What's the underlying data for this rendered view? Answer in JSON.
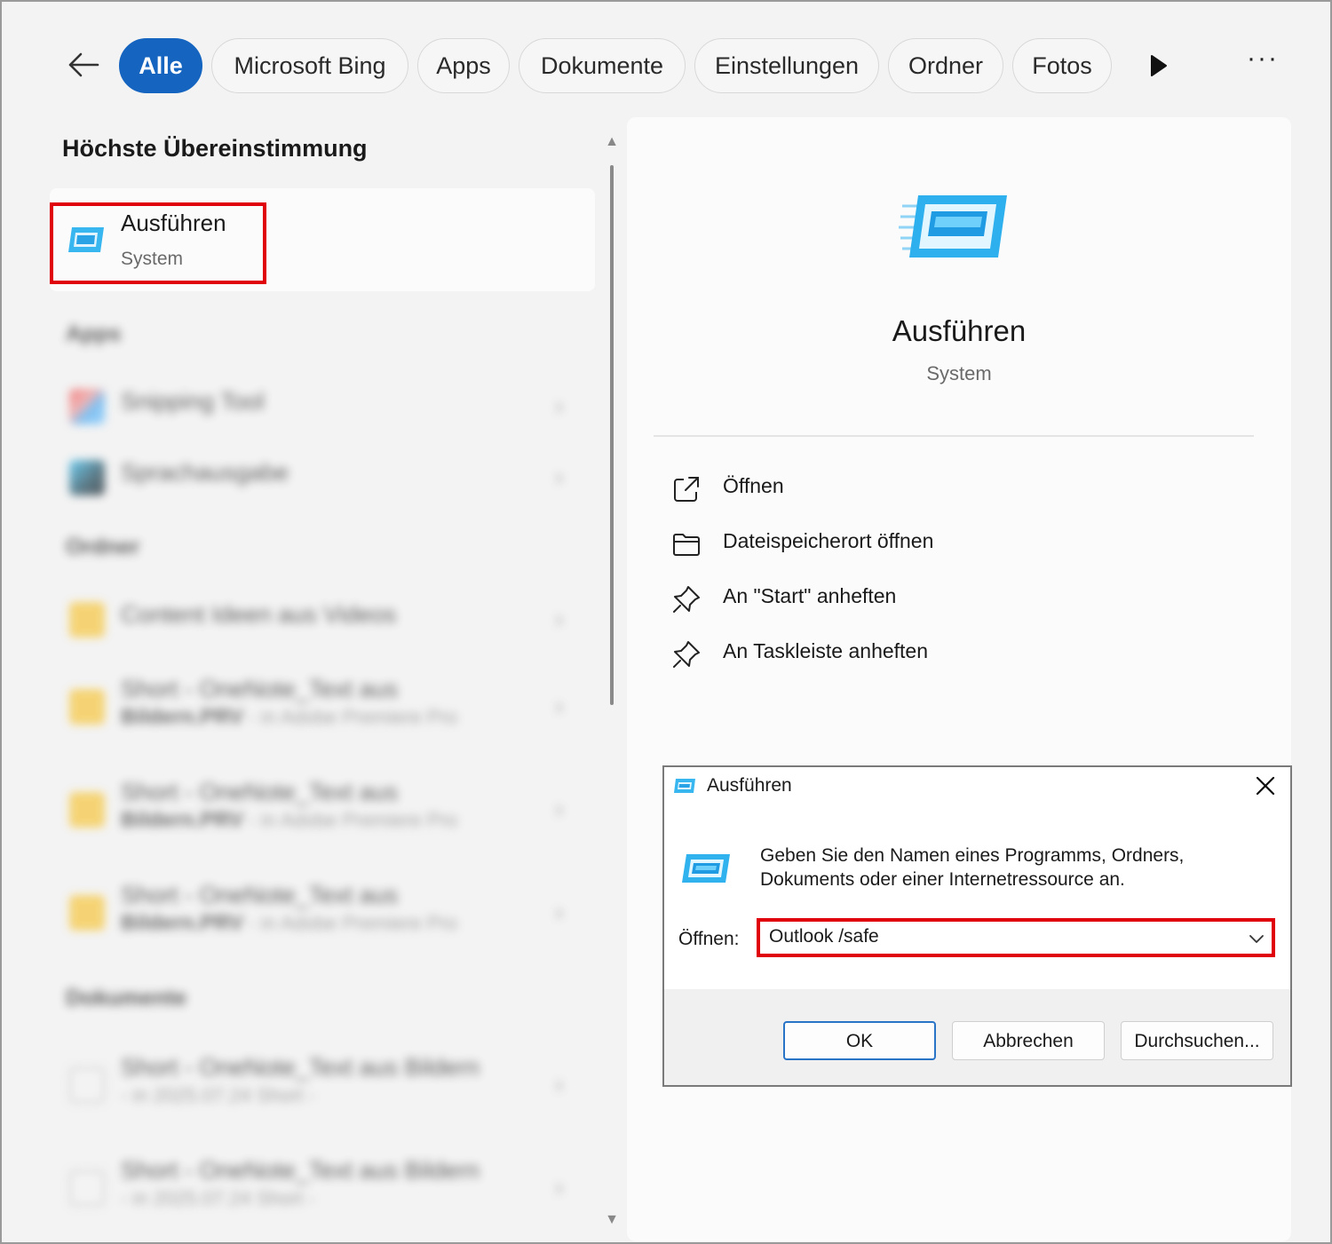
{
  "filters": {
    "tabs": [
      {
        "label": "Alle",
        "active": true
      },
      {
        "label": "Microsoft Bing"
      },
      {
        "label": "Apps"
      },
      {
        "label": "Dokumente"
      },
      {
        "label": "Einstellungen"
      },
      {
        "label": "Ordner"
      },
      {
        "label": "Fotos"
      }
    ],
    "more_label": "···"
  },
  "results": {
    "best_match_heading": "Höchste Übereinstimmung",
    "best_match": {
      "title": "Ausführen",
      "subtitle": "System"
    },
    "apps_heading": "Apps",
    "apps": [
      {
        "label": "Snipping Tool"
      },
      {
        "label": "Sprachausgabe"
      }
    ],
    "folders_heading": "Ordner",
    "folders": [
      {
        "label": "Content Ideen aus Videos"
      },
      {
        "line1": "Short - OneNote_Text aus",
        "line2": "Bildern.PRV",
        "location": " - in Adobe Premiere Pro"
      },
      {
        "line1": "Short - OneNote_Text aus",
        "line2": "Bildern.PRV",
        "location": " - in Adobe Premiere Pro"
      },
      {
        "line1": "Short - OneNote_Text aus",
        "line2": "Bildern.PRV",
        "location": " - in Adobe Premiere Pro"
      }
    ],
    "documents_heading": "Dokumente",
    "documents": [
      {
        "line1": "Short - OneNote_Text aus Bildern",
        "location": "- in 2025.07.24 Short -"
      },
      {
        "line1": "Short - OneNote_Text aus Bildern",
        "location": "- in 2025.07.24 Short -"
      }
    ]
  },
  "detail": {
    "title": "Ausführen",
    "subtitle": "System",
    "actions": [
      {
        "label": "Öffnen",
        "icon": "open-external-icon"
      },
      {
        "label": "Dateispeicherort öffnen",
        "icon": "folder-icon"
      },
      {
        "label": "An \"Start\" anheften",
        "icon": "pin-icon"
      },
      {
        "label": "An Taskleiste anheften",
        "icon": "pin-icon"
      }
    ]
  },
  "run_dialog": {
    "title": "Ausführen",
    "description": "Geben Sie den Namen eines Programms, Ordners, Dokuments oder einer Internetressource an.",
    "open_label": "Öffnen:",
    "input_value": "Outlook /safe",
    "buttons": {
      "ok": "OK",
      "cancel": "Abbrechen",
      "browse": "Durchsuchen..."
    }
  },
  "colors": {
    "accent": "#1565c0",
    "highlight": "#e0000b"
  }
}
